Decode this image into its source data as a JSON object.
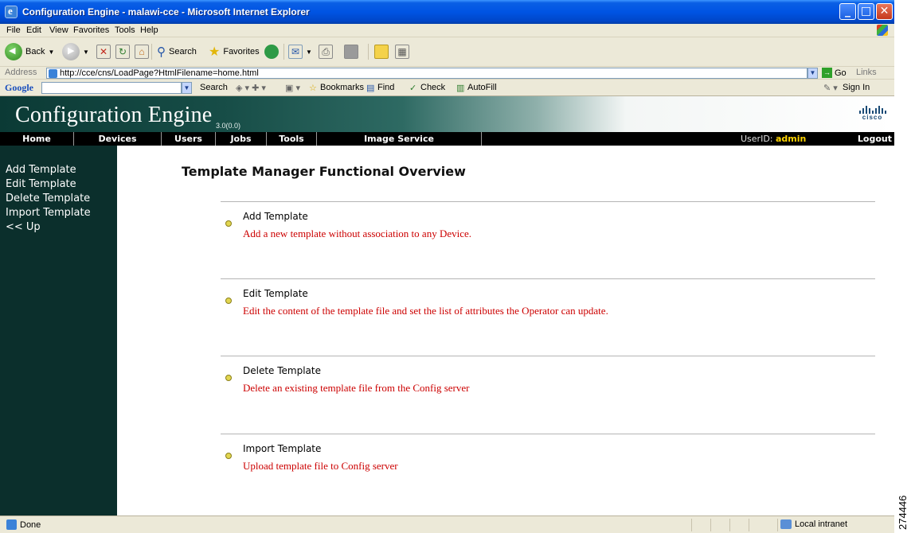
{
  "window": {
    "title": "Configuration Engine - malawi-cce - Microsoft Internet Explorer",
    "buttons": {
      "minimize": "_",
      "maximize": "□",
      "close": "✕"
    }
  },
  "menubar": {
    "items": [
      "File",
      "Edit",
      "View",
      "Favorites",
      "Tools",
      "Help"
    ]
  },
  "toolbar": {
    "back": "Back",
    "search": "Search",
    "favorites": "Favorites"
  },
  "address": {
    "label": "Address",
    "url": "http://cce/cns/LoadPage?HtmlFilename=home.html",
    "go": "Go",
    "links": "Links"
  },
  "googlebar": {
    "logo": "Google",
    "items": [
      "Search",
      "Bookmarks",
      "Find",
      "Check",
      "AutoFill"
    ],
    "signin": "Sign In"
  },
  "banner": {
    "title": "Configuration Engine",
    "version": "3.0(0.0)",
    "brand": "cisco"
  },
  "nav": {
    "items": [
      "Home",
      "Devices",
      "Users",
      "Jobs",
      "Tools",
      "Image Service"
    ],
    "userid_label": "UserID:",
    "userid": "admin",
    "logout": "Logout"
  },
  "sidebar": {
    "items": [
      "Add Template",
      "Edit Template",
      "Delete Template",
      "Import Template",
      "<< Up"
    ]
  },
  "main": {
    "heading": "Template Manager Functional Overview",
    "sections": [
      {
        "title": "Add Template",
        "description": "Add a new template without association to any Device."
      },
      {
        "title": "Edit Template",
        "description": "Edit the content of the template file and set the list of attributes the Operator can update."
      },
      {
        "title": "Delete Template",
        "description": "Delete an existing template file from the Config server"
      },
      {
        "title": "Import Template",
        "description": "Upload template file to Config server"
      }
    ]
  },
  "status": {
    "text": "Done",
    "zone": "Local intranet"
  },
  "figure_number": "274446"
}
